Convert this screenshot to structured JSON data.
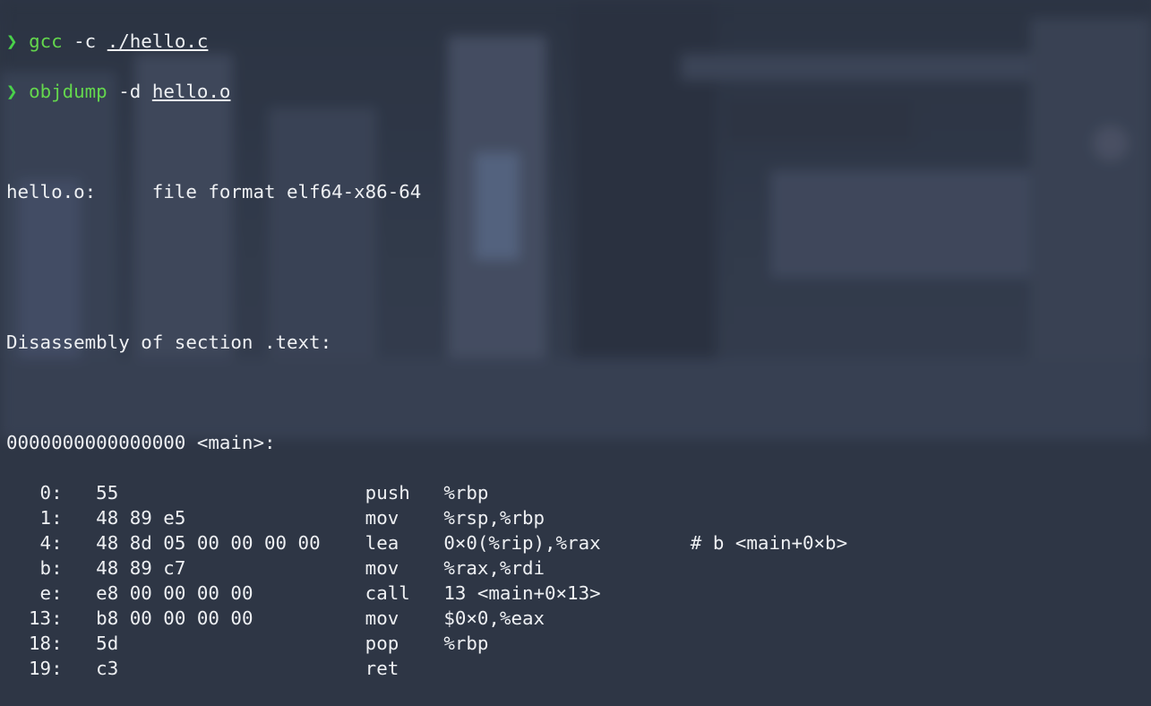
{
  "prompt_symbol": "❯",
  "colors": {
    "background": "#2e3645",
    "text": "#eef0f3",
    "prompt": "#49d14a",
    "command": "#64d74d"
  },
  "commands": [
    {
      "cmd": "gcc",
      "args": " -c ",
      "path": "./hello.c"
    },
    {
      "cmd": "objdump",
      "args": " -d ",
      "path": "hello.o"
    }
  ],
  "output": {
    "file_format_line": "hello.o:     file format elf64-x86-64",
    "section_line": "Disassembly of section .text:",
    "symbol_line": "0000000000000000 <main>:",
    "instructions": [
      {
        "addr": "   0:",
        "bytes": "55",
        "mnemonic": "push",
        "operands": "%rbp",
        "comment": ""
      },
      {
        "addr": "   1:",
        "bytes": "48 89 e5",
        "mnemonic": "mov",
        "operands": "%rsp,%rbp",
        "comment": ""
      },
      {
        "addr": "   4:",
        "bytes": "48 8d 05 00 00 00 00",
        "mnemonic": "lea",
        "operands": "0×0(%rip),%rax",
        "comment": "# b <main+0×b>"
      },
      {
        "addr": "   b:",
        "bytes": "48 89 c7",
        "mnemonic": "mov",
        "operands": "%rax,%rdi",
        "comment": ""
      },
      {
        "addr": "   e:",
        "bytes": "e8 00 00 00 00",
        "mnemonic": "call",
        "operands": "13 <main+0×13>",
        "comment": ""
      },
      {
        "addr": "  13:",
        "bytes": "b8 00 00 00 00",
        "mnemonic": "mov",
        "operands": "$0×0,%eax",
        "comment": ""
      },
      {
        "addr": "  18:",
        "bytes": "5d",
        "mnemonic": "pop",
        "operands": "%rbp",
        "comment": ""
      },
      {
        "addr": "  19:",
        "bytes": "c3",
        "mnemonic": "ret",
        "operands": "",
        "comment": ""
      }
    ]
  }
}
